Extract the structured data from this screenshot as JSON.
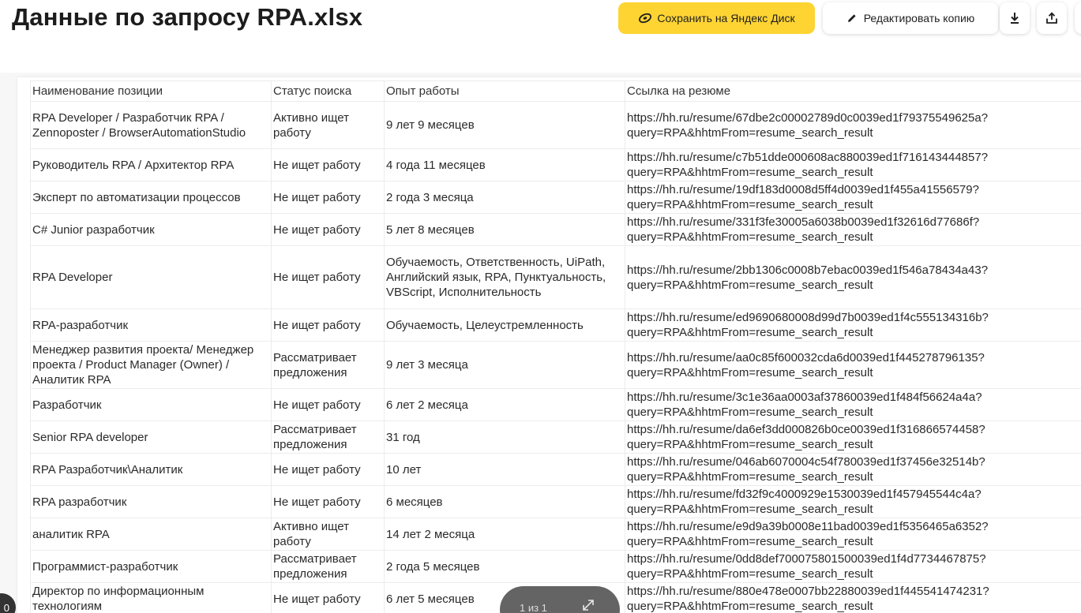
{
  "document": {
    "title": "Данные по запросу RPA.xlsx"
  },
  "toolbar": {
    "save_label": "Сохранить на Яндекс Диск",
    "edit_label": "Редактировать копию",
    "download_icon": "download-icon",
    "share_icon": "share-icon",
    "accent_color": "#fed433"
  },
  "table": {
    "headers": [
      "Наименование позиции",
      "Статус поиска",
      "Опыт работы",
      "Ссылка на резюме"
    ],
    "rows": [
      {
        "position": "RPA Developer / Разработчик RPA / Zennoposter / BrowserAutomationStudio",
        "status": "Активно ищет работу",
        "experience": "9 лет 9 месяцев",
        "link": "https://hh.ru/resume/67dbe2c00002789d0c0039ed1f79375549625a?\nquery=RPA&hhtmFrom=resume_search_result"
      },
      {
        "position": "Руководитель RPA / Архитектор RPA",
        "status": "Не ищет работу",
        "experience": "4 года 11 месяцев",
        "link": "https://hh.ru/resume/c7b51dde000608ac880039ed1f716143444857?\nquery=RPA&hhtmFrom=resume_search_result"
      },
      {
        "position": "Эксперт по автоматизации процессов",
        "status": "Не ищет работу",
        "experience": "2 года 3 месяца",
        "link": "https://hh.ru/resume/19df183d0008d5ff4d0039ed1f455a41556579?\nquery=RPA&hhtmFrom=resume_search_result"
      },
      {
        "position": "C# Junior разработчик",
        "status": "Не ищет работу",
        "experience": "5 лет 8 месяцев",
        "link": "https://hh.ru/resume/331f3fe30005a6038b0039ed1f32616d77686f?\nquery=RPA&hhtmFrom=resume_search_result"
      },
      {
        "position": "RPA Developer",
        "status": "Не ищет работу",
        "experience": "Обучаемость, Ответственность, UiPath, Английский язык, RPA, Пунктуальность, VBScript, Исполнительность",
        "link": "https://hh.ru/resume/2bb1306c0008b7ebac0039ed1f546a78434a43?\nquery=RPA&hhtmFrom=resume_search_result"
      },
      {
        "position": "RPA-разработчик",
        "status": "Не ищет работу",
        "experience": "Обучаемость, Целеустремленность",
        "link": "https://hh.ru/resume/ed9690680008d99d7b0039ed1f4c555134316b?\nquery=RPA&hhtmFrom=resume_search_result"
      },
      {
        "position": "Менеджер развития проекта/ Менеджер проекта / Product Manager (Owner) / Аналитик RPA",
        "status": "Рассматривает предложения",
        "experience": "9 лет 3 месяца",
        "link": "https://hh.ru/resume/aa0c85f600032cda6d0039ed1f445278796135?\nquery=RPA&hhtmFrom=resume_search_result"
      },
      {
        "position": "Разработчик",
        "status": "Не ищет работу",
        "experience": "6 лет 2 месяца",
        "link": "https://hh.ru/resume/3c1e36aa0003af37860039ed1f484f56624a4a?\nquery=RPA&hhtmFrom=resume_search_result"
      },
      {
        "position": "Senior RPA developer",
        "status": "Рассматривает предложения",
        "experience": "31 год",
        "link": "https://hh.ru/resume/da6ef3dd000826b0ce0039ed1f316866574458?\nquery=RPA&hhtmFrom=resume_search_result"
      },
      {
        "position": "RPA Разработчик\\Аналитик",
        "status": "Не ищет работу",
        "experience": "10 лет",
        "link": "https://hh.ru/resume/046ab6070004c54f780039ed1f37456e32514b?\nquery=RPA&hhtmFrom=resume_search_result"
      },
      {
        "position": "RPA разработчик",
        "status": "Не ищет работу",
        "experience": "6 месяцев",
        "link": "https://hh.ru/resume/fd32f9c4000929e1530039ed1f457945544c4a?\nquery=RPA&hhtmFrom=resume_search_result"
      },
      {
        "position": "аналитик RPA",
        "status": "Активно ищет работу",
        "experience": "14 лет 2 месяца",
        "link": "https://hh.ru/resume/e9d9a39b0008e11bad0039ed1f5356465a6352?\nquery=RPA&hhtmFrom=resume_search_result"
      },
      {
        "position": "Программист-разработчик",
        "status": "Рассматривает предложения",
        "experience": "2 года 5 месяцев",
        "link": "https://hh.ru/resume/0dd8def700075801500039ed1f4d7734467875?\nquery=RPA&hhtmFrom=resume_search_result"
      },
      {
        "position": "Директор по информационным технологиям",
        "status": "Не ищет работу",
        "experience": "6 лет 5 месяцев",
        "link": "https://hh.ru/resume/880e478e0007bb22880039ed1f445541474231?\nquery=RPA&hhtmFrom=resume_search_result"
      }
    ]
  },
  "pager": {
    "label": "1 из 1",
    "expand_icon": "expand-icon"
  },
  "corner_button": {
    "label": "0"
  }
}
